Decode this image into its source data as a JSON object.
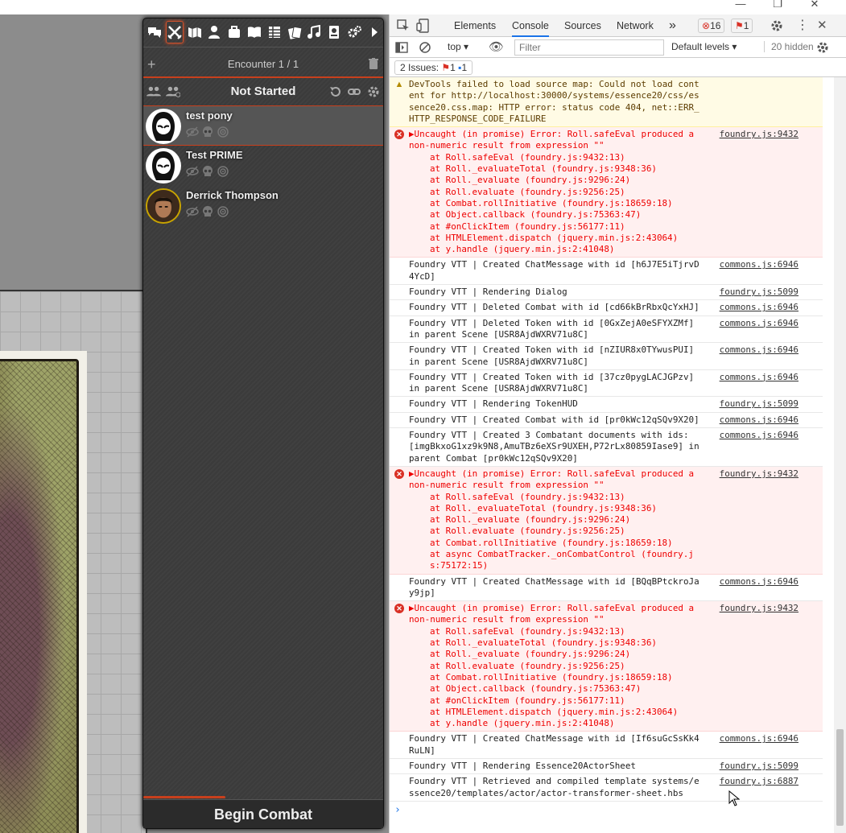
{
  "window": {
    "minimize": "—",
    "restore": "❐",
    "close": "✕"
  },
  "sidebar": {
    "tabs": [
      "chat",
      "combat",
      "scenes",
      "actors",
      "items",
      "journal",
      "tables",
      "cards",
      "playlists",
      "compendium",
      "settings",
      "collapse"
    ],
    "encounter_title": "Encounter 1 / 1",
    "status_title": "Not Started",
    "combatants": [
      {
        "name": "test pony"
      },
      {
        "name": "Test PRIME"
      },
      {
        "name": "Derrick Thompson"
      }
    ],
    "begin_label": "Begin Combat",
    "accent": "#c8401d"
  },
  "devtools": {
    "tabs": [
      "Elements",
      "Console",
      "Sources",
      "Network"
    ],
    "more": "»",
    "error_count": "16",
    "issue_badge_count": "1",
    "context": "top",
    "filter_placeholder": "Filter",
    "levels": "Default levels",
    "hidden": "20 hidden",
    "issues_label": "2 Issues:",
    "issues_err": "1",
    "issues_info": "1",
    "messages": [
      {
        "type": "warn",
        "text": "DevTools failed to load source map: Could not load content for http://localhost:30000/systems/essence20/css/essence20.css.map: HTTP error: status code 404, net::ERR_HTTP_RESPONSE_CODE_FAILURE",
        "src": ""
      },
      {
        "type": "err",
        "text": "▶Uncaught (in promise) Error: Roll.safeEval produced a non-numeric result from expression \"\"",
        "src": "foundry.js:9432",
        "stack": [
          "at Roll.safeEval (foundry.js:9432:13)",
          "at Roll._evaluateTotal (foundry.js:9348:36)",
          "at Roll._evaluate (foundry.js:9296:24)",
          "at Roll.evaluate (foundry.js:9256:25)",
          "at Combat.rollInitiative (foundry.js:18659:18)",
          "at Object.callback (foundry.js:75363:47)",
          "at #onClickItem (foundry.js:56177:11)",
          "at HTMLElement.dispatch (jquery.min.js:2:43064)",
          "at y.handle (jquery.min.js:2:41048)"
        ]
      },
      {
        "type": "log",
        "text": "Foundry VTT | Created ChatMessage with id [h6J7E5iTjrvD4YcD]",
        "src": "commons.js:6946"
      },
      {
        "type": "log",
        "text": "Foundry VTT | Rendering Dialog",
        "src": "foundry.js:5099"
      },
      {
        "type": "log",
        "text": "Foundry VTT | Deleted Combat with id [cd66kBrRbxQcYxHJ]",
        "src": "commons.js:6946"
      },
      {
        "type": "log",
        "text": "Foundry VTT | Deleted Token with id [0GxZejA0eSFYXZMf] in parent Scene [USR8AjdWXRV71u8C]",
        "src": "commons.js:6946"
      },
      {
        "type": "log",
        "text": "Foundry VTT | Created Token with id [nZIUR8x0TYwusPUI] in parent Scene [USR8AjdWXRV71u8C]",
        "src": "commons.js:6946"
      },
      {
        "type": "log",
        "text": "Foundry VTT | Created Token with id [37cz0pygLACJGPzv] in parent Scene [USR8AjdWXRV71u8C]",
        "src": "commons.js:6946"
      },
      {
        "type": "log",
        "text": "Foundry VTT | Rendering TokenHUD",
        "src": "foundry.js:5099"
      },
      {
        "type": "log",
        "text": "Foundry VTT | Created Combat with id [pr0kWc12qSQv9X20]",
        "src": "commons.js:6946"
      },
      {
        "type": "log",
        "text": "Foundry VTT | Created 3 Combatant documents with ids: [imgBkxoG1xz9k9N8,AmuTBz6eXSr9UXEH,P72rLx80859Iase9] in parent Combat [pr0kWc12qSQv9X20]",
        "src": "commons.js:6946"
      },
      {
        "type": "err",
        "text": "▶Uncaught (in promise) Error: Roll.safeEval produced a non-numeric result from expression \"\"",
        "src": "foundry.js:9432",
        "stack": [
          "at Roll.safeEval (foundry.js:9432:13)",
          "at Roll._evaluateTotal (foundry.js:9348:36)",
          "at Roll._evaluate (foundry.js:9296:24)",
          "at Roll.evaluate (foundry.js:9256:25)",
          "at Combat.rollInitiative (foundry.js:18659:18)",
          "at async CombatTracker._onCombatControl (foundry.js:75172:15)"
        ]
      },
      {
        "type": "log",
        "text": "Foundry VTT | Created ChatMessage with id [BQqBPtckroJay9jp]",
        "src": "commons.js:6946"
      },
      {
        "type": "err",
        "text": "▶Uncaught (in promise) Error: Roll.safeEval produced a non-numeric result from expression \"\"",
        "src": "foundry.js:9432",
        "stack": [
          "at Roll.safeEval (foundry.js:9432:13)",
          "at Roll._evaluateTotal (foundry.js:9348:36)",
          "at Roll._evaluate (foundry.js:9296:24)",
          "at Roll.evaluate (foundry.js:9256:25)",
          "at Combat.rollInitiative (foundry.js:18659:18)",
          "at Object.callback (foundry.js:75363:47)",
          "at #onClickItem (foundry.js:56177:11)",
          "at HTMLElement.dispatch (jquery.min.js:2:43064)",
          "at y.handle (jquery.min.js:2:41048)"
        ]
      },
      {
        "type": "log",
        "text": "Foundry VTT | Created ChatMessage with id [If6suGcSsKk4RuLN]",
        "src": "commons.js:6946"
      },
      {
        "type": "log",
        "text": "Foundry VTT | Rendering Essence20ActorSheet",
        "src": "foundry.js:5099"
      },
      {
        "type": "log",
        "text": "Foundry VTT | Retrieved and compiled template systems/essence20/templates/actor/actor-transformer-sheet.hbs",
        "src": "foundry.js:6887"
      }
    ],
    "prompt": "›"
  }
}
